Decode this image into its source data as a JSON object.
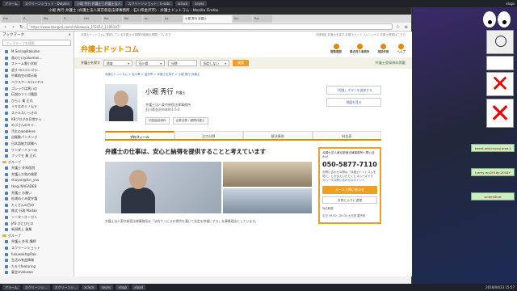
{
  "taskbar_top": {
    "items": [
      "アラーム",
      "スクリーンショット - Dolphin",
      "小堀 秀行 弁護士 | 弁護士法人",
      "スクリーンショット - k-sato",
      "xclock",
      "seyes"
    ],
    "right": "xlogo"
  },
  "taskbar_bottom": {
    "items": [
      "アラーム",
      "スクリーンシ...",
      "スクリーンシ...",
      "xclock",
      "seyes",
      "xlogo",
      "xload"
    ],
    "clock": "2018/04/23 15:57"
  },
  "browser": {
    "title": "小堀 秀行 弁護士 (弁護士法人東京新宿法律事務所 - 石川県金沢市) - 弁護士ドットコム - Mozilla Firefox",
    "tabs": [
      "Gm",
      "P..",
      "Mo",
      "P..",
      "Hel",
      "Rai",
      "Rei",
      "ta..",
      "ha",
      "小堀 秀行 弁護士",
      "Kin",
      "Rai"
    ],
    "active_tab_index": 9,
    "url": "https://www.bengo4.com/ishikawa/a_17201/l_1106147/"
  },
  "sidebar": {
    "title": "ブックマーク",
    "close": "×",
    "search_placeholder": "ブックマークを検索",
    "items": [
      {
        "label": "M.Sorin@Rakuten",
        "folder": false
      },
      {
        "label": "島のヒロyakuman...",
        "folder": false
      },
      {
        "label": "ストーム雲小学校",
        "folder": false
      },
      {
        "label": "逃すヨロコンゴラ...",
        "folder": false
      },
      {
        "label": "中華航空の掲示板",
        "folder": false
      },
      {
        "label": "ハウスケーキロイヤル",
        "folder": false
      },
      {
        "label": "ゴシックは黒いの",
        "folder": false
      },
      {
        "label": "伝説のリンゴ農園",
        "folder": false
      },
      {
        "label": "ひらく 業 正式",
        "folder": false
      },
      {
        "label": "ミキなのミノムラ",
        "folder": false
      },
      {
        "label": "ステルスいっきの",
        "folder": false
      },
      {
        "label": "KBブログの日常から",
        "folder": false
      },
      {
        "label": "のぶさんのキャ...",
        "folder": false
      },
      {
        "label": "汚れのwebHere",
        "folder": false
      },
      {
        "label": "自衛動パンチング",
        "folder": false
      },
      {
        "label": "日本語能力試験へ",
        "folder": false
      },
      {
        "label": "ワンダーミラーの",
        "folder": false
      },
      {
        "label": "ブックモ 業 正式",
        "folder": false
      },
      {
        "label": "グループ",
        "folder": true
      },
      {
        "label": "弁護士 外科医院",
        "folder": false
      },
      {
        "label": "弁護士大和の検索",
        "folder": false
      },
      {
        "label": "shayarl@tcn_you",
        "folder": false
      },
      {
        "label": "tkngi.NAGADEB",
        "folder": false
      },
      {
        "label": "弁護士 お願い",
        "folder": false
      },
      {
        "label": "松浦めぐみ愛弁護",
        "folder": false
      },
      {
        "label": "たくさんの目の",
        "folder": false
      },
      {
        "label": "株式 行政 Madao",
        "folder": false
      },
      {
        "label": "ソーターオーガニ",
        "folder": false
      },
      {
        "label": "JAS ひとひとの",
        "folder": false
      },
      {
        "label": "新潟県上 乗業",
        "folder": false
      },
      {
        "label": "グループ",
        "folder": true
      },
      {
        "label": "弁護士 外科 講師",
        "folder": false
      },
      {
        "label": "スクリーンショット",
        "folder": false
      },
      {
        "label": "fukuwakh@Rak",
        "folder": false
      },
      {
        "label": "生活の有益情報",
        "folder": false
      },
      {
        "label": "たろうfeaturing",
        "folder": false
      },
      {
        "label": "宴会shinkawa",
        "folder": false
      }
    ]
  },
  "site": {
    "top_note": "弁護士ドットコムに登録している弁護士の事務所情報を掲載しています",
    "top_links": "法律相談   弁護士を探す   弁護士ドットコムニュース   弁護士登録はこちら",
    "logo": "弁護士ドットコム",
    "head_icons": [
      "閲覧履歴",
      "最近見た事務所",
      "相談件数",
      "ヘルプ"
    ],
    "search_label": "弁護士を探す",
    "area_select": "地域",
    "pref_select": "石川県",
    "field_select": "分野",
    "field_value": "指定しない",
    "search_button": "検索",
    "register_link": "弁護士登録無料掲載",
    "breadcrumb": "弁護士ドットコム > 石川県 > 金沢市 > 弁護士を探す > 小堀 秀行 弁護士",
    "lawyer_name": "小堀 秀行",
    "lawyer_title": "弁護士",
    "firm_line1": "弁護士法人東京新宿法律事務所",
    "firm_line2": "石川県金沢市本町1-5-2",
    "cat1": "初回面談無料",
    "cat2": "企業法務・顧問弁護士",
    "side_btn1": "「相談」ボタンを追加する",
    "side_btn2": "地図を見る",
    "tabs": [
      "プロフィール",
      "注力分野",
      "解決事例",
      "料金表"
    ],
    "headline": "弁護士の仕事は、安心と納得を提供することと考えています",
    "body_text": "弁護士法人東京新宿法律事務所は「法的サービスの提供を通じて社会を幸福にする」を事業理念としています。",
    "contact_title": "弁護士法人東京新宿法律事務所へ問い合わせ",
    "phone": "050-5877-7110",
    "contact_note": "お問い合わせの際は「弁護士ドットコムを見た」とお伝えいただくとスムーズです",
    "contact_link": "スムーズな問い合わせのポイント",
    "mail_button": "メールで問い合わせ",
    "fav_button": "お気に入りに追加",
    "hours_title": "対応時間",
    "hours": "平日 09:00 - 20:00 土日祝 要予約"
  },
  "desktop": {
    "note1": "tweet-add-mysql-area-t",
    "note2": "t-emy-my2018y-2018Y",
    "note3": "screenShot"
  }
}
